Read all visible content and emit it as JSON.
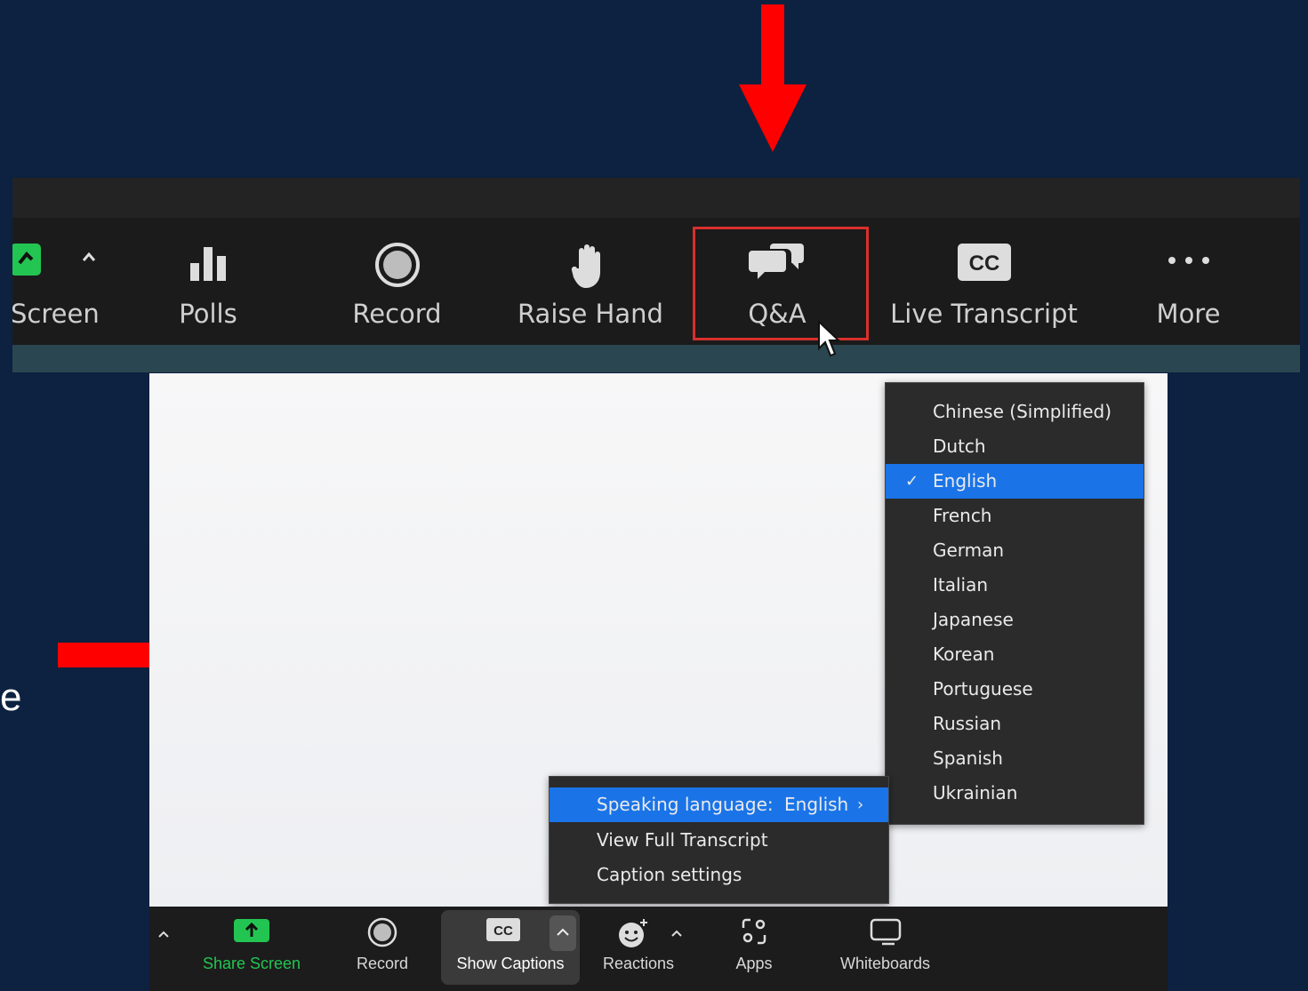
{
  "top_toolbar": {
    "items": [
      {
        "label": "Screen",
        "icon": "share-screen-icon"
      },
      {
        "label": "Polls",
        "icon": "polls-icon"
      },
      {
        "label": "Record",
        "icon": "record-icon"
      },
      {
        "label": "Raise Hand",
        "icon": "raise-hand-icon"
      },
      {
        "label": "Q&A",
        "icon": "qa-chat-icon"
      },
      {
        "label": "Live Transcript",
        "icon": "cc-icon",
        "badge": "CC"
      },
      {
        "label": "More",
        "icon": "more-icon"
      }
    ]
  },
  "slide_fragment": "e",
  "language_menu": {
    "items": [
      {
        "label": "Chinese (Simplified)",
        "selected": false
      },
      {
        "label": "Dutch",
        "selected": false
      },
      {
        "label": "English",
        "selected": true
      },
      {
        "label": "French",
        "selected": false
      },
      {
        "label": "German",
        "selected": false
      },
      {
        "label": "Italian",
        "selected": false
      },
      {
        "label": "Japanese",
        "selected": false
      },
      {
        "label": "Korean",
        "selected": false
      },
      {
        "label": "Portuguese",
        "selected": false
      },
      {
        "label": "Russian",
        "selected": false
      },
      {
        "label": "Spanish",
        "selected": false
      },
      {
        "label": "Ukrainian",
        "selected": false
      }
    ],
    "check_mark": "✓"
  },
  "caption_menu": {
    "speaking_language_label": "Speaking language:",
    "speaking_language_value": "English",
    "chevron": "›",
    "view_full_transcript": "View Full Transcript",
    "caption_settings": "Caption settings"
  },
  "bottom_toolbar": {
    "caret": "^",
    "items": [
      {
        "label": "Share Screen",
        "icon": "share-screen-icon"
      },
      {
        "label": "Record",
        "icon": "record-icon"
      },
      {
        "label": "Show Captions",
        "icon": "cc-icon",
        "badge": "CC"
      },
      {
        "label": "Reactions",
        "icon": "reactions-icon"
      },
      {
        "label": "Apps",
        "icon": "apps-icon"
      },
      {
        "label": "Whiteboards",
        "icon": "whiteboard-icon"
      }
    ]
  },
  "colors": {
    "background": "#0d2140",
    "arrow": "#ff0000",
    "highlight_border": "#d9302c",
    "menu_selected": "#1a74e8",
    "share_green": "#23c552"
  }
}
